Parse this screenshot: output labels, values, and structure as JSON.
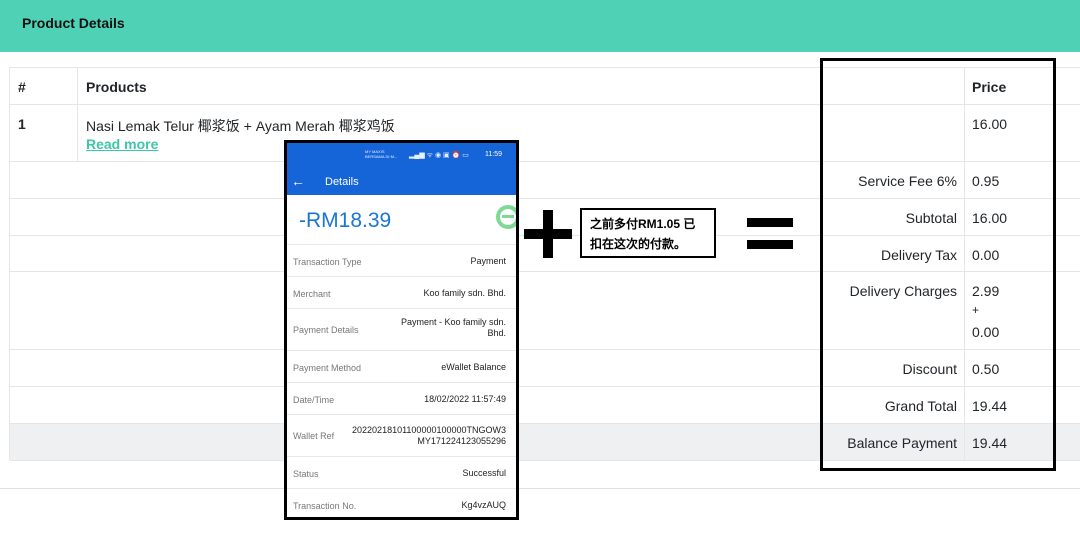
{
  "header": {
    "title": "Product Details"
  },
  "table": {
    "col_index_header": "#",
    "col_products_header": "Products",
    "col_price_header": "Price",
    "item": {
      "index": "1",
      "name": "Nasi Lemak Telur 椰浆饭 + Ayam Merah 椰浆鸡饭",
      "read_more": "Read more",
      "price": "16.00"
    },
    "summary": [
      {
        "label": "Service Fee 6%",
        "value": "0.95"
      },
      {
        "label": "Subtotal",
        "value": "16.00"
      },
      {
        "label": "Delivery Tax",
        "value": "0.00"
      },
      {
        "label": "Delivery Charges",
        "value_line1": "2.99",
        "value_line2": "+",
        "value_line3": "0.00"
      },
      {
        "label": "Discount",
        "value": "0.50"
      },
      {
        "label": "Grand Total",
        "value": "19.44"
      },
      {
        "label": "Balance Payment",
        "value": "19.44"
      }
    ]
  },
  "phone": {
    "status_carrier_line1": "MY MAXIS",
    "status_carrier_line2": "BERSAMA DI M...",
    "status_icons": "▂▄▆ ᯤ ◉ ▣ ⏰ ▭",
    "status_time": "11:59",
    "appbar_title": "Details",
    "amount": "-RM18.39",
    "rows": [
      {
        "label": "Transaction Type",
        "value": "Payment"
      },
      {
        "label": "Merchant",
        "value": "Koo family sdn. Bhd."
      },
      {
        "label": "Payment Details",
        "value_line1": "Payment - Koo family sdn.",
        "value_line2": "Bhd."
      },
      {
        "label": "Payment Method",
        "value": "eWallet Balance"
      },
      {
        "label": "Date/Time",
        "value": "18/02/2022 11:57:49"
      },
      {
        "label": "Wallet Ref",
        "value_line1": "20220218101100000100000TNGOW3",
        "value_line2": "MY171224123055296"
      },
      {
        "label": "Status",
        "value": "Successful"
      },
      {
        "label": "Transaction No.",
        "value": "Kg4vzAUQ"
      }
    ]
  },
  "annotation": {
    "note_line1": "之前多付RM1.05 已",
    "note_line2": "扣在这次的付款。"
  },
  "colors": {
    "header_bg": "#4fd1b5",
    "link": "#3ec6a8",
    "phone_blue": "#1565d8",
    "amount_blue": "#1976d2"
  },
  "icons": [
    "back-arrow-icon",
    "wallet-status-icon",
    "plus-sign",
    "equals-sign"
  ]
}
